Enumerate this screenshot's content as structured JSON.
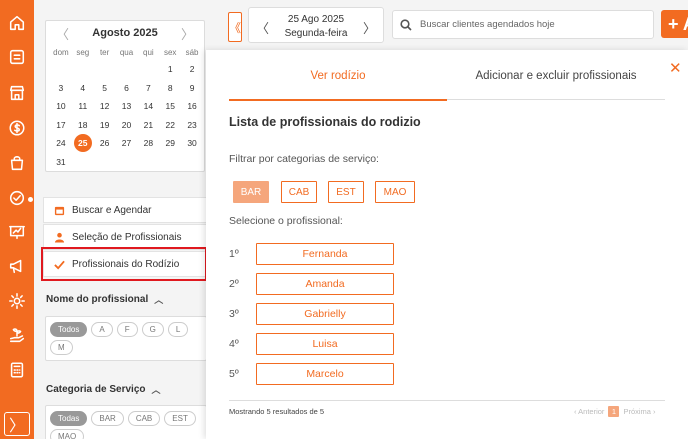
{
  "rail": {
    "icons": [
      "home-icon",
      "store-icon",
      "shop-icon",
      "dollar-icon",
      "bag-icon",
      "badge-check-icon",
      "presentation-icon",
      "megaphone-icon",
      "gear-icon",
      "plant-hand-icon",
      "calculator-icon"
    ],
    "expand_label": "〉",
    "accent": "#f26b21"
  },
  "calendar": {
    "prev": "〈",
    "next": "〉",
    "month": "Agosto 2025",
    "weekdays": [
      "dom",
      "seg",
      "ter",
      "qua",
      "qui",
      "sex",
      "sáb"
    ],
    "weeks": [
      [
        "",
        "",
        "",
        "",
        "",
        "1",
        "2"
      ],
      [
        "3",
        "4",
        "5",
        "6",
        "7",
        "8",
        "9"
      ],
      [
        "10",
        "11",
        "12",
        "13",
        "14",
        "15",
        "16"
      ],
      [
        "17",
        "18",
        "19",
        "20",
        "21",
        "22",
        "23"
      ],
      [
        "24",
        "25",
        "26",
        "27",
        "28",
        "29",
        "30"
      ],
      [
        "31",
        "",
        "",
        "",
        "",
        "",
        ""
      ]
    ],
    "selected": "25"
  },
  "menu": {
    "search_schedule": "Buscar e Agendar",
    "select_professionals": "Seleção de Profissionais",
    "rotation_professionals": "Profissionais do Rodízio"
  },
  "filters": {
    "professional_title": "Nome do profissional",
    "professional_chips": [
      "Todos",
      "A",
      "F",
      "G",
      "L",
      "M"
    ],
    "category_title": "Categoria de Serviço",
    "category_chips": [
      "Todas",
      "BAR",
      "CAB",
      "EST",
      "MAO"
    ]
  },
  "topbar": {
    "collapse": "《",
    "date_prev": "〈",
    "date_next": "〉",
    "date": "25 Ago 2025",
    "weekday": "Segunda-feira",
    "search_placeholder": "Buscar clientes agendados hoje",
    "add_label": "+ A"
  },
  "modal": {
    "close": "✕",
    "tab_view": "Ver rodízio",
    "tab_manage": "Adicionar e excluir profissionais",
    "title": "Lista de profissionais do rodizio",
    "filter_label": "Filtrar por categorias de serviço:",
    "categories": [
      "BAR",
      "CAB",
      "EST",
      "MAO"
    ],
    "active_category": "BAR",
    "select_label": "Selecione o profissional:",
    "professionals": [
      {
        "pos": "1º",
        "name": "Fernanda"
      },
      {
        "pos": "2º",
        "name": "Amanda"
      },
      {
        "pos": "3º",
        "name": "Gabrielly"
      },
      {
        "pos": "4º",
        "name": "Luisa"
      },
      {
        "pos": "5º",
        "name": "Marcelo"
      }
    ],
    "results": "Mostrando 5 resultados de 5",
    "pager": {
      "prev": "‹ Anterior",
      "page": "1",
      "next": "Próxima ›"
    }
  }
}
